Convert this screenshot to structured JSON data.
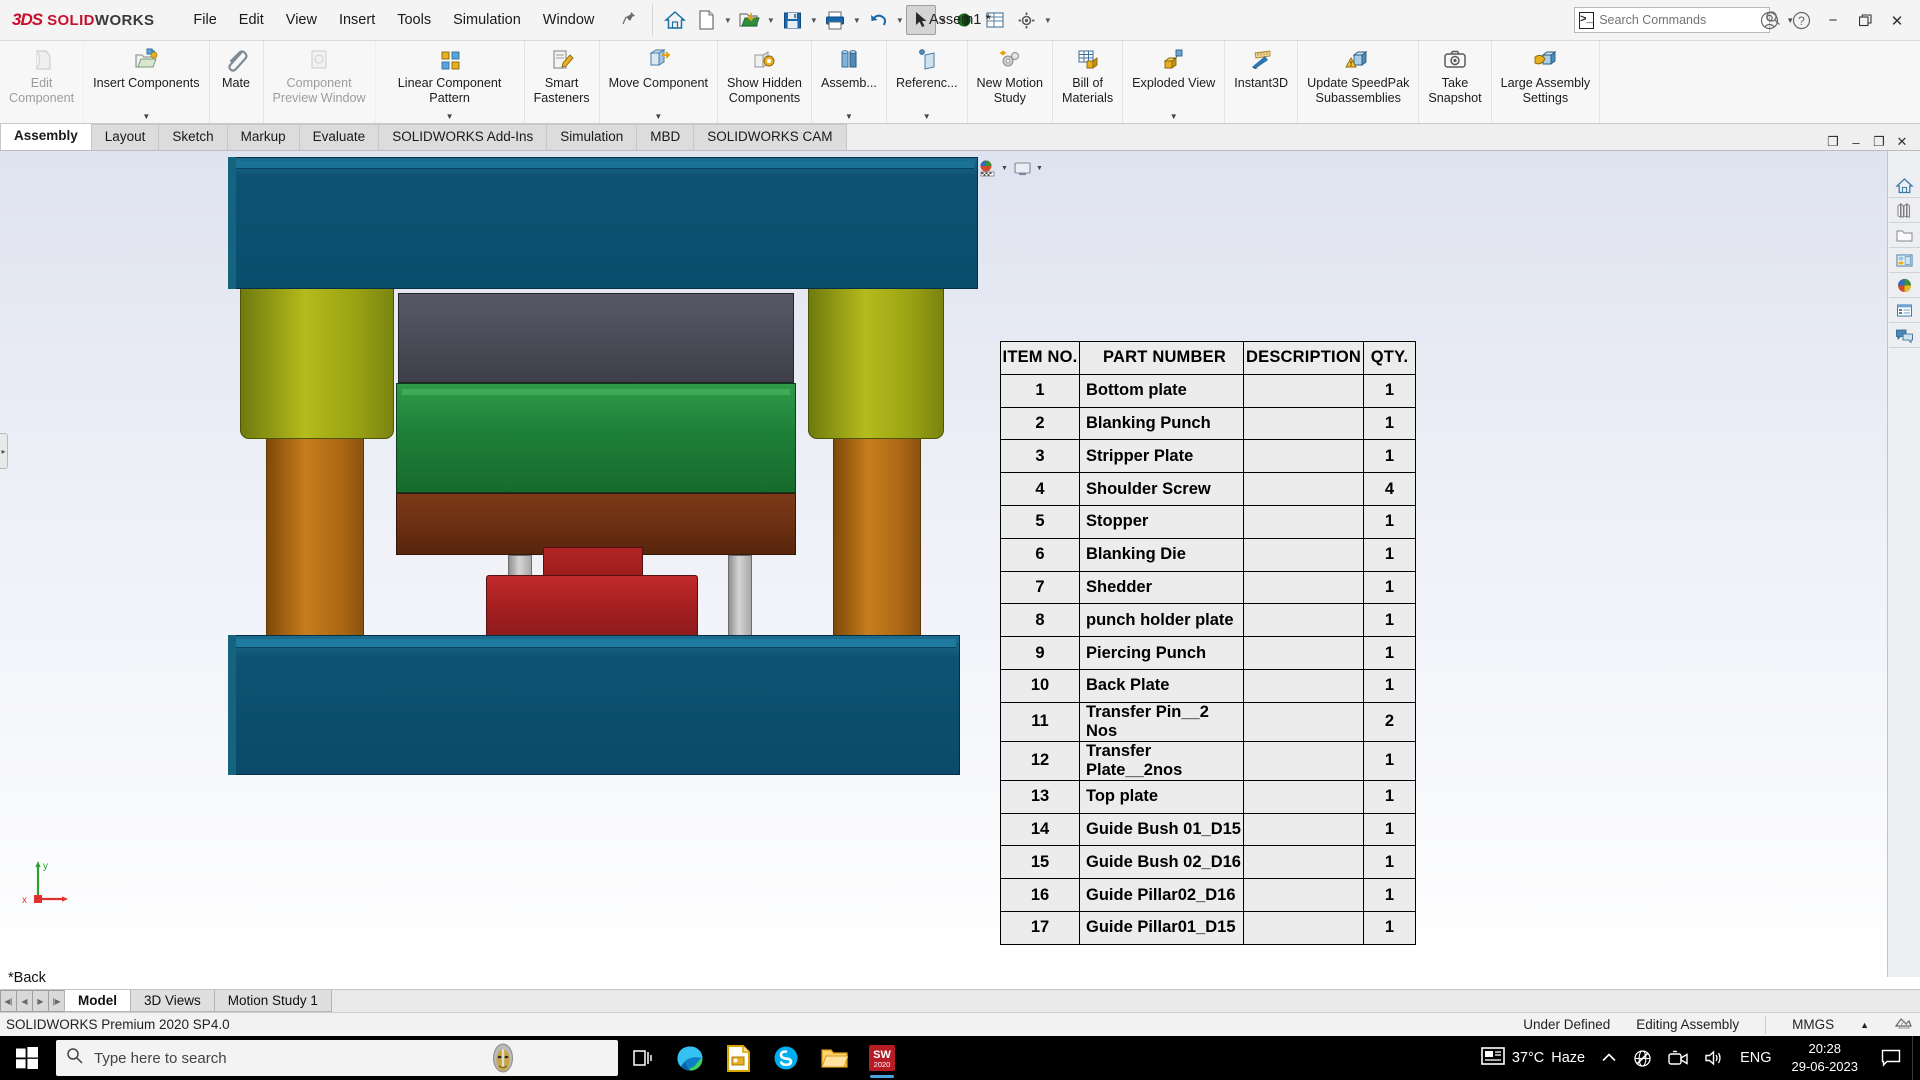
{
  "titlebar": {
    "brand_3ds": "3DS",
    "brand_solid": "SOLID",
    "brand_works": "WORKS",
    "menu": [
      "File",
      "Edit",
      "View",
      "Insert",
      "Tools",
      "Simulation",
      "Window"
    ],
    "pin_icon": "pushpin-icon",
    "quick_access": [
      {
        "name": "home-icon",
        "label": "Home"
      },
      {
        "name": "new-document-icon",
        "label": "New"
      },
      {
        "name": "open-document-icon",
        "label": "Open"
      },
      {
        "name": "save-icon",
        "label": "Save"
      },
      {
        "name": "print-icon",
        "label": "Print"
      },
      {
        "name": "undo-icon",
        "label": "Undo"
      },
      {
        "name": "select-arrow-icon",
        "label": "Select"
      },
      {
        "name": "appearance-sphere-icon",
        "label": "Edit Appearance"
      },
      {
        "name": "display-pane-icon",
        "label": "Display Pane"
      },
      {
        "name": "options-gear-icon",
        "label": "Options"
      }
    ],
    "document_title": "Assem1 *",
    "search": {
      "placeholder": "Search Commands",
      "icon": "search-icon",
      "dropdown_icon": "chevron-down-icon"
    },
    "account_icon": "user-account-icon",
    "help_icon": "help-question-icon",
    "window_controls": {
      "minimize": "minimize-icon",
      "restore": "restore-icon",
      "close": "close-icon"
    }
  },
  "ribbon": {
    "items": [
      {
        "label": "Edit\nComponent",
        "label1": "Edit",
        "label2": "Component",
        "icon": "edit-component-icon",
        "disabled": true,
        "dropdown": false
      },
      {
        "label1": "Insert Components",
        "label2": "",
        "icon": "insert-components-icon",
        "disabled": false,
        "dropdown": true
      },
      {
        "label1": "Mate",
        "label2": "",
        "icon": "mate-paperclip-icon",
        "disabled": false,
        "dropdown": false
      },
      {
        "label1": "Component",
        "label2": "Preview Window",
        "icon": "component-preview-icon",
        "disabled": true,
        "dropdown": false
      },
      {
        "label1": "Linear Component Pattern",
        "label2": "",
        "icon": "linear-component-pattern-icon",
        "disabled": false,
        "dropdown": true
      },
      {
        "label1": "Smart",
        "label2": "Fasteners",
        "icon": "smart-fasteners-icon",
        "disabled": false,
        "dropdown": false
      },
      {
        "label1": "Move Component",
        "label2": "",
        "icon": "move-component-icon",
        "disabled": false,
        "dropdown": true
      },
      {
        "label1": "Show Hidden",
        "label2": "Components",
        "icon": "show-hidden-components-icon",
        "disabled": false,
        "dropdown": false
      },
      {
        "label1": "Assemb...",
        "label2": "",
        "icon": "assembly-features-icon",
        "disabled": false,
        "dropdown": true
      },
      {
        "label1": "Referenc...",
        "label2": "",
        "icon": "reference-geometry-icon",
        "disabled": false,
        "dropdown": true
      },
      {
        "label1": "New Motion",
        "label2": "Study",
        "icon": "new-motion-study-icon",
        "disabled": false,
        "dropdown": false
      },
      {
        "label1": "Bill of",
        "label2": "Materials",
        "icon": "bill-of-materials-icon",
        "disabled": false,
        "dropdown": false
      },
      {
        "label1": "Exploded View",
        "label2": "",
        "icon": "exploded-view-icon",
        "disabled": false,
        "dropdown": true
      },
      {
        "label1": "Instant3D",
        "label2": "",
        "icon": "instant3d-icon",
        "disabled": false,
        "dropdown": false
      },
      {
        "label1": "Update SpeedPak",
        "label2": "Subassemblies",
        "icon": "update-speedpak-icon",
        "disabled": false,
        "dropdown": false
      },
      {
        "label1": "Take",
        "label2": "Snapshot",
        "icon": "take-snapshot-camera-icon",
        "disabled": false,
        "dropdown": false
      },
      {
        "label1": "Large Assembly",
        "label2": "Settings",
        "icon": "large-assembly-settings-icon",
        "disabled": false,
        "dropdown": false
      }
    ]
  },
  "command_tabs": {
    "tabs": [
      {
        "label": "Assembly",
        "active": true
      },
      {
        "label": "Layout",
        "active": false
      },
      {
        "label": "Sketch",
        "active": false
      },
      {
        "label": "Markup",
        "active": false
      },
      {
        "label": "Evaluate",
        "active": false
      },
      {
        "label": "SOLIDWORKS Add-Ins",
        "active": false
      },
      {
        "label": "Simulation",
        "active": false
      },
      {
        "label": "MBD",
        "active": false
      },
      {
        "label": "SOLIDWORKS CAM",
        "active": false
      }
    ],
    "right_controls": [
      {
        "name": "restore-pane-icon",
        "glyph": "❐"
      },
      {
        "name": "minimize-window-icon",
        "glyph": "–"
      },
      {
        "name": "restore-window-icon",
        "glyph": "❐"
      },
      {
        "name": "close-window-icon",
        "glyph": "✕"
      }
    ]
  },
  "view_toolbar": {
    "tools": [
      {
        "name": "zoom-to-fit-icon",
        "dropdown": false
      },
      {
        "name": "zoom-to-area-icon",
        "dropdown": false
      },
      {
        "name": "previous-view-icon",
        "dropdown": false
      },
      {
        "name": "section-view-icon",
        "dropdown": false
      },
      {
        "name": "view-orientation-icon",
        "dropdown": false
      },
      {
        "name": "display-style-icon",
        "dropdown": true
      },
      {
        "name": "hide-show-items-icon",
        "dropdown": true
      },
      {
        "name": "view-settings-icon",
        "dropdown": true
      },
      {
        "name": "edit-appearance-icon",
        "dropdown": false
      },
      {
        "name": "apply-scene-icon",
        "dropdown": true
      },
      {
        "name": "view-setting-display-icon",
        "dropdown": true
      }
    ]
  },
  "bom": {
    "headers": [
      "ITEM NO.",
      "PART NUMBER",
      "DESCRIPTION",
      "QTY."
    ],
    "rows": [
      {
        "item": "1",
        "part": "Bottom plate",
        "description": "",
        "qty": "1"
      },
      {
        "item": "2",
        "part": "Blanking Punch",
        "description": "",
        "qty": "1"
      },
      {
        "item": "3",
        "part": "Stripper Plate",
        "description": "",
        "qty": "1"
      },
      {
        "item": "4",
        "part": "Shoulder Screw",
        "description": "",
        "qty": "4"
      },
      {
        "item": "5",
        "part": "Stopper",
        "description": "",
        "qty": "1"
      },
      {
        "item": "6",
        "part": "Blanking Die",
        "description": "",
        "qty": "1"
      },
      {
        "item": "7",
        "part": "Shedder",
        "description": "",
        "qty": "1"
      },
      {
        "item": "8",
        "part": "punch holder plate",
        "description": "",
        "qty": "1"
      },
      {
        "item": "9",
        "part": "Piercing Punch",
        "description": "",
        "qty": "1"
      },
      {
        "item": "10",
        "part": "Back Plate",
        "description": "",
        "qty": "1"
      },
      {
        "item": "11",
        "part": "Transfer Pin__2 Nos",
        "description": "",
        "qty": "2"
      },
      {
        "item": "12",
        "part": "Transfer Plate__2nos",
        "description": "",
        "qty": "1"
      },
      {
        "item": "13",
        "part": "Top plate",
        "description": "",
        "qty": "1"
      },
      {
        "item": "14",
        "part": "Guide Bush 01_D15",
        "description": "",
        "qty": "1"
      },
      {
        "item": "15",
        "part": "Guide Bush 02_D16",
        "description": "",
        "qty": "1"
      },
      {
        "item": "16",
        "part": "Guide Pillar02_D16",
        "description": "",
        "qty": "1"
      },
      {
        "item": "17",
        "part": "Guide Pillar01_D15",
        "description": "",
        "qty": "1"
      }
    ]
  },
  "task_pane": {
    "icons": [
      {
        "name": "solidworks-resources-home-icon"
      },
      {
        "name": "design-library-icon"
      },
      {
        "name": "file-explorer-icon"
      },
      {
        "name": "view-palette-icon"
      },
      {
        "name": "appearances-scenes-decals-icon"
      },
      {
        "name": "custom-properties-icon"
      },
      {
        "name": "solidworks-forum-icon"
      }
    ]
  },
  "graphics": {
    "feature_label": "*Back",
    "triad": {
      "x_label": "x",
      "y_label": "y",
      "color_x": "#e03030",
      "color_y": "#2fa02f"
    },
    "model_colors": {
      "top_bottom_plate": "#0d5madeup",
      "blue_plate": "#10536f",
      "olive_bush": "#9aa314",
      "orange_pillar": "#b8701a",
      "dark_gray_plate": "#4a4a56",
      "green_plate": "#1c7a34",
      "brown_plate": "#6e2f14",
      "red_punch": "#b41f20",
      "silver_pin": "#b8b8b8"
    }
  },
  "model_tabs": {
    "nav_buttons": [
      "first-sheet-icon",
      "previous-sheet-icon",
      "next-sheet-icon",
      "last-sheet-icon"
    ],
    "tabs": [
      {
        "label": "Model",
        "active": true
      },
      {
        "label": "3D Views",
        "active": false
      },
      {
        "label": "Motion Study 1",
        "active": false
      }
    ]
  },
  "status_bar": {
    "product": "SOLIDWORKS Premium 2020 SP4.0",
    "state": "Under Defined",
    "mode": "Editing Assembly",
    "units": "MMGS",
    "units_caret": "caret-up-icon",
    "overlay_icon": "overlay-icon"
  },
  "taskbar": {
    "start_icon": "windows-start-icon",
    "search": {
      "placeholder": "Type here to search",
      "icon": "search-icon",
      "cortana_icon": "assistant-avatar-icon"
    },
    "pinned": [
      {
        "name": "task-view-icon",
        "running": false
      },
      {
        "name": "microsoft-edge-icon",
        "running": false
      },
      {
        "name": "libreoffice-impress-icon",
        "running": false
      },
      {
        "name": "skype-icon",
        "running": false
      },
      {
        "name": "file-explorer-icon",
        "running": false
      },
      {
        "name": "solidworks-2020-icon",
        "running": true,
        "badge": "SW",
        "badge2": "2020"
      }
    ],
    "tray": {
      "news_icon": "news-weather-icon",
      "temperature": "37°C",
      "weather": "Haze",
      "chevron_icon": "show-hidden-icons-chevron",
      "network_icon": "network-disconnected-icon",
      "meet_icon": "meet-now-icon",
      "volume_icon": "volume-icon",
      "language": "ENG",
      "time": "20:28",
      "date": "29-06-2023",
      "action_center_icon": "action-center-icon"
    }
  }
}
